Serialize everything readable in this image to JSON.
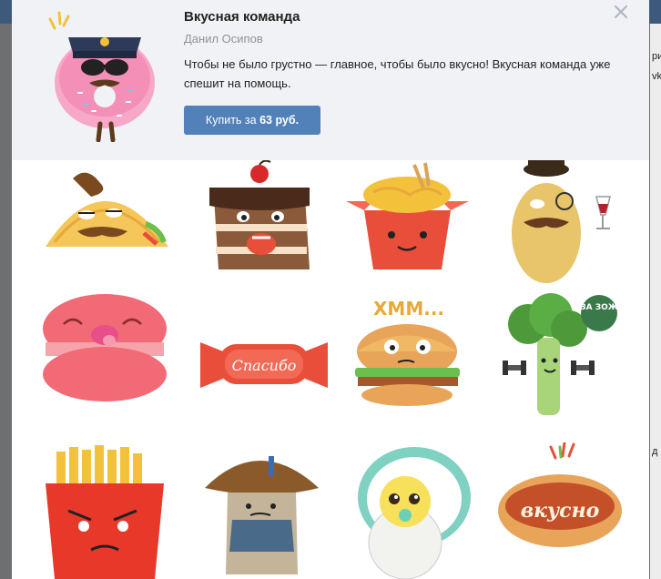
{
  "pack": {
    "title": "Вкусная команда",
    "author": "Данил Осипов",
    "description": "Чтобы не было грустно — главное, чтобы было вкусно! Вкусная команда уже спешит на помощь.",
    "buy_prefix": "Купить за",
    "buy_price": "63 руб."
  },
  "background": {
    "right_text_1": "рик",
    "right_text_2": "vk",
    "right_text_3": "д"
  },
  "stickers": [
    {
      "name": "taco-sticker"
    },
    {
      "name": "cake-sticker"
    },
    {
      "name": "noodles-box-sticker"
    },
    {
      "name": "potato-gentleman-sticker"
    },
    {
      "name": "macaron-sticker",
      "caption": ""
    },
    {
      "name": "candy-thanks-sticker",
      "caption": "Спасибо"
    },
    {
      "name": "burger-thinking-sticker",
      "caption": "ХММ..."
    },
    {
      "name": "broccoli-gym-sticker",
      "caption": "ЗА ЗОЖ"
    },
    {
      "name": "fries-angry-sticker"
    },
    {
      "name": "mushroom-sticker"
    },
    {
      "name": "egg-baby-sticker"
    },
    {
      "name": "hotdog-tasty-sticker",
      "caption": "вкусно"
    }
  ],
  "colors": {
    "accent": "#5181b8",
    "header_bg": "#f0f2f5"
  }
}
